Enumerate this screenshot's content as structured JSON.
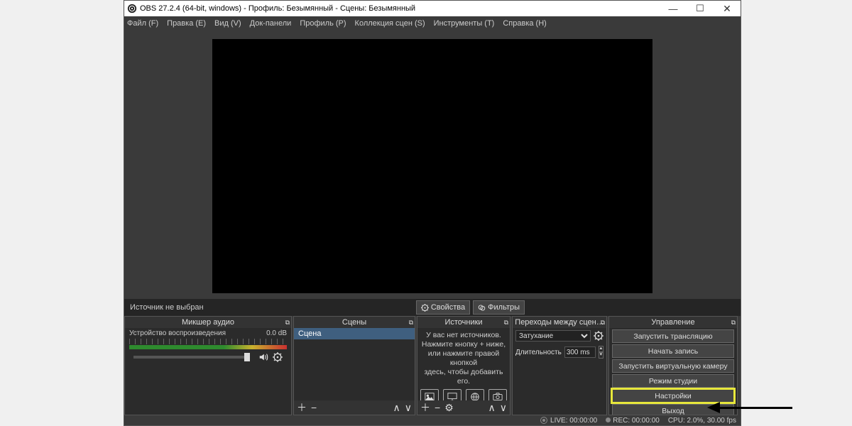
{
  "window": {
    "title": "OBS 27.2.4 (64-bit, windows) - Профиль: Безымянный - Сцены: Безымянный",
    "min": "—",
    "max": "☐",
    "close": "✕"
  },
  "menu": {
    "file": "Файл (F)",
    "edit": "Правка (E)",
    "view": "Вид (V)",
    "docks": "Док-панели",
    "profile": "Профиль (P)",
    "scene_coll": "Коллекция сцен (S)",
    "tools": "Инструменты (T)",
    "help": "Справка (H)"
  },
  "infobar": {
    "no_source": "Источник не выбран",
    "props": "Свойства",
    "filters": "Фильтры"
  },
  "docks": {
    "mixer": {
      "title": "Микшер аудио",
      "track_name": "Устройство воспроизведения",
      "track_db": "0.0 dB"
    },
    "scenes": {
      "title": "Сцены",
      "item": "Сцена"
    },
    "sources": {
      "title": "Источники",
      "hint1": "У вас нет источников.",
      "hint2": "Нажмите кнопку + ниже,",
      "hint3": "или нажмите правой кнопкой",
      "hint4": "здесь, чтобы добавить его."
    },
    "transitions": {
      "title": "Переходы между сцен…",
      "fade": "Затухание",
      "duration_lbl": "Длительность",
      "duration_val": "300 ms"
    },
    "controls": {
      "title": "Управление",
      "start_stream": "Запустить трансляцию",
      "start_record": "Начать запись",
      "start_vcam": "Запустить виртуальную камеру",
      "studio": "Режим студии",
      "settings": "Настройки",
      "exit": "Выход"
    }
  },
  "status": {
    "live": "LIVE: 00:00:00",
    "rec": "REC: 00:00:00",
    "cpu": "CPU: 2.0%, 30.00 fps"
  }
}
